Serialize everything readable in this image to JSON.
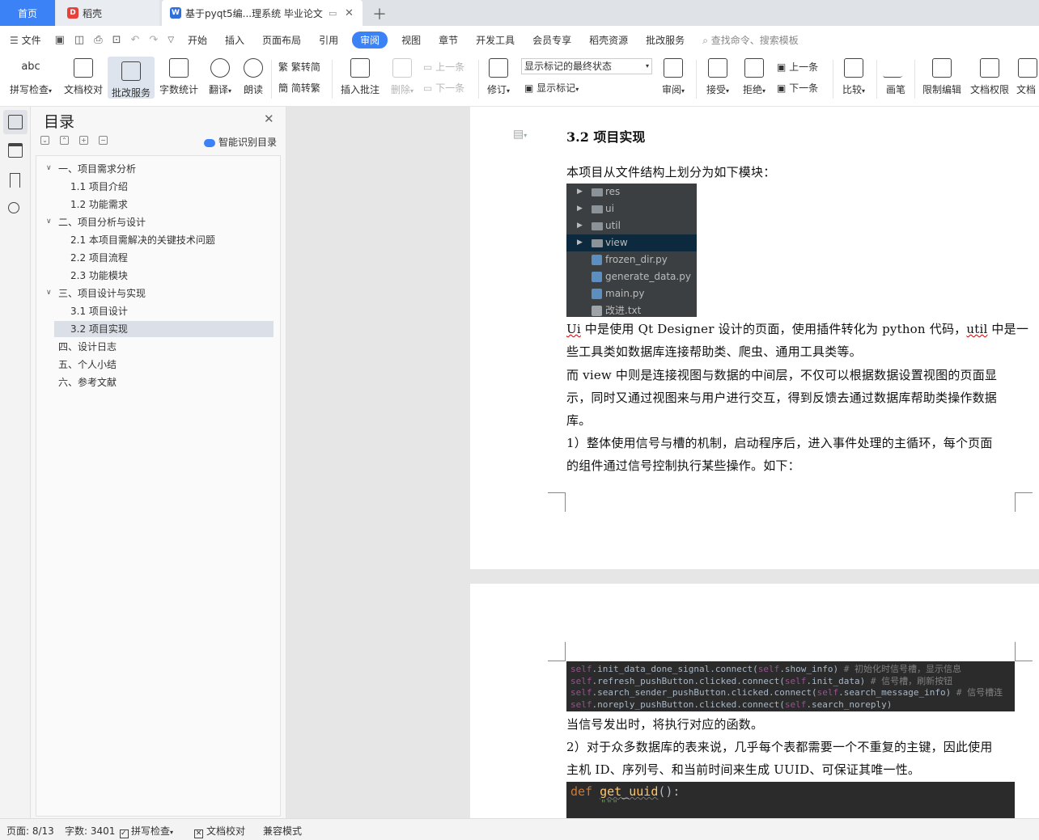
{
  "tabs": {
    "home": "首页",
    "daoke": "稻壳",
    "doc": "基于pyqt5编...理系统 毕业论文"
  },
  "menu": [
    "文件",
    "开始",
    "插入",
    "页面布局",
    "引用",
    "审阅",
    "视图",
    "章节",
    "开发工具",
    "会员专享",
    "稻壳资源",
    "批改服务"
  ],
  "menu_active": "审阅",
  "search_placeholder": "查找命令、搜索模板",
  "ribbon": {
    "spell": "拼写检查",
    "proofread": "文档校对",
    "review_service": "批改服务",
    "wordcount": "字数统计",
    "translate": "翻译",
    "read": "朗读",
    "trad": "繁转简",
    "simp": "简转繁",
    "insert_comment": "插入批注",
    "delete": "删除",
    "prev": "上一条",
    "next": "下一条",
    "revise": "修订",
    "mark_state": "显示标记的最终状态",
    "show_marks": "显示标记",
    "review": "审阅",
    "accept": "接受",
    "reject": "拒绝",
    "prev2": "上一条",
    "next2": "下一条",
    "compare": "比较",
    "pen": "画笔",
    "restrict": "限制编辑",
    "perm": "文档权限",
    "more": "文档"
  },
  "toc": {
    "title": "目录",
    "smart": "智能识别目录",
    "items": [
      {
        "label": "一、项目需求分析",
        "level": 1,
        "expanded": true
      },
      {
        "label": "1.1 项目介绍",
        "level": 2
      },
      {
        "label": "1.2 功能需求",
        "level": 2
      },
      {
        "label": "二、项目分析与设计",
        "level": 1,
        "expanded": true
      },
      {
        "label": "2.1 本项目需解决的关键技术问题",
        "level": 2
      },
      {
        "label": "2.2 项目流程",
        "level": 2
      },
      {
        "label": "2.3 功能模块",
        "level": 2
      },
      {
        "label": "三、项目设计与实现",
        "level": 1,
        "expanded": true
      },
      {
        "label": "3.1 项目设计",
        "level": 2
      },
      {
        "label": "3.2 项目实现",
        "level": 2,
        "selected": true
      },
      {
        "label": "四、设计日志",
        "level": 1
      },
      {
        "label": "五、个人小结",
        "level": 1
      },
      {
        "label": "六、参考文献",
        "level": 1
      }
    ]
  },
  "doc": {
    "heading": "3.2 项目实现",
    "p1": "本项目从文件结构上划分为如下模块：",
    "files": [
      {
        "name": "res",
        "type": "folder"
      },
      {
        "name": "ui",
        "type": "folder"
      },
      {
        "name": "util",
        "type": "folder"
      },
      {
        "name": "view",
        "type": "folder",
        "selected": true
      },
      {
        "name": "frozen_dir.py",
        "type": "py"
      },
      {
        "name": "generate_data.py",
        "type": "py"
      },
      {
        "name": "main.py",
        "type": "py"
      },
      {
        "name": "改进.txt",
        "type": "txt"
      }
    ],
    "p2a_ui": "Ui",
    "p2a_rest1": " 中是使用 Qt Designer 设计的页面，使用插件转化为 python 代码，",
    "p2a_util": "util",
    "p2a_rest2": " 中是一",
    "p2b": "些工具类如数据库连接帮助类、爬虫、通用工具类等。",
    "p3a": "而 view 中则是连接视图与数据的中间层，不仅可以根据数据设置视图的页面显",
    "p3b": "示，同时又通过视图来与用户进行交互，得到反馈去通过数据库帮助类操作数据",
    "p3c": "库。",
    "p4a": "1）整体使用信号与槽的机制，启动程序后，进入事件处理的主循环，每个页面",
    "p4b": "的组件通过信号控制执行某些操作。如下：",
    "code1": [
      {
        "a": "self",
        "b": ".init_data_done_signal.connect(",
        "c": "self",
        ".d": "",
        "d": ".show_info)  ",
        "e": "# 初始化时信号槽，显示信息"
      },
      {
        "a": "self",
        "b": ".refresh_pushButton.clicked.connect(",
        "c": "self",
        "d": ".init_data)  ",
        "e": "# 信号槽，刷新按钮"
      },
      {
        "a": "self",
        "b": ".search_sender_pushButton.clicked.connect(",
        "c": "self",
        "d": ".search_message_info)  ",
        "e": "# 信号槽连"
      },
      {
        "a": "self",
        "b": ".noreply_pushButton.clicked.connect(",
        "c": "self",
        "d": ".search_noreply)",
        "e": ""
      }
    ],
    "p5": "当信号发出时，将执行对应的函数。",
    "p6a": "2）对于众多数据库的表来说，几乎每个表都需要一个不重复的主键，因此使用",
    "p6b": "主机 ID、序列号、和当前时间来生成 UUID、可保证其唯一性。",
    "code2_kw": "def ",
    "code2_fn": "get_uuid",
    "code2_rest": "():",
    "code2_doc": "\"\"\""
  },
  "status": {
    "page": "页面: 8/13",
    "words": "字数: 3401",
    "spell": "拼写检查",
    "proof": "文档校对",
    "compat": "兼容模式"
  },
  "colors": {
    "accent": "#3b82f6",
    "code_bg": "#2b2b2b",
    "tree_bg": "#3c3f41"
  }
}
